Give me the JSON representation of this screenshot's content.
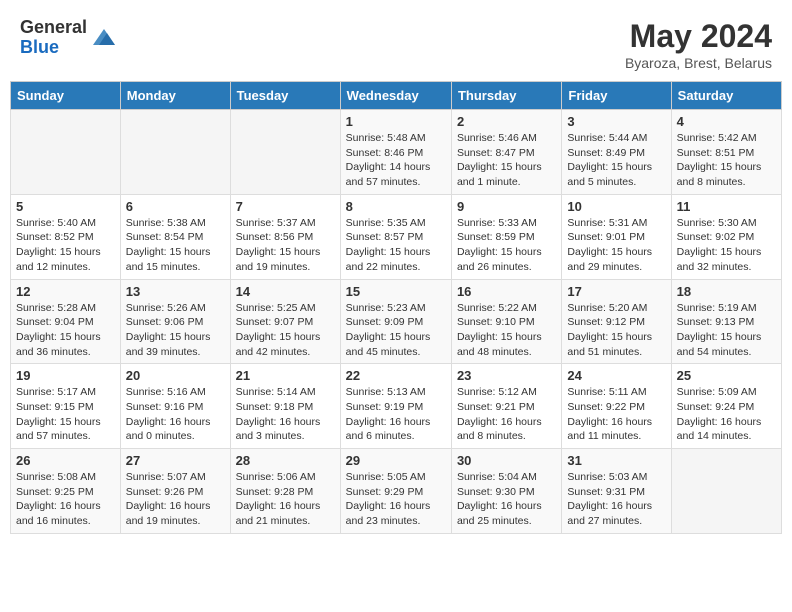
{
  "header": {
    "logo_line1": "General",
    "logo_line2": "Blue",
    "month": "May 2024",
    "location": "Byaroza, Brest, Belarus"
  },
  "weekdays": [
    "Sunday",
    "Monday",
    "Tuesday",
    "Wednesday",
    "Thursday",
    "Friday",
    "Saturday"
  ],
  "weeks": [
    [
      {
        "day": "",
        "info": ""
      },
      {
        "day": "",
        "info": ""
      },
      {
        "day": "",
        "info": ""
      },
      {
        "day": "1",
        "info": "Sunrise: 5:48 AM\nSunset: 8:46 PM\nDaylight: 14 hours\nand 57 minutes."
      },
      {
        "day": "2",
        "info": "Sunrise: 5:46 AM\nSunset: 8:47 PM\nDaylight: 15 hours\nand 1 minute."
      },
      {
        "day": "3",
        "info": "Sunrise: 5:44 AM\nSunset: 8:49 PM\nDaylight: 15 hours\nand 5 minutes."
      },
      {
        "day": "4",
        "info": "Sunrise: 5:42 AM\nSunset: 8:51 PM\nDaylight: 15 hours\nand 8 minutes."
      }
    ],
    [
      {
        "day": "5",
        "info": "Sunrise: 5:40 AM\nSunset: 8:52 PM\nDaylight: 15 hours\nand 12 minutes."
      },
      {
        "day": "6",
        "info": "Sunrise: 5:38 AM\nSunset: 8:54 PM\nDaylight: 15 hours\nand 15 minutes."
      },
      {
        "day": "7",
        "info": "Sunrise: 5:37 AM\nSunset: 8:56 PM\nDaylight: 15 hours\nand 19 minutes."
      },
      {
        "day": "8",
        "info": "Sunrise: 5:35 AM\nSunset: 8:57 PM\nDaylight: 15 hours\nand 22 minutes."
      },
      {
        "day": "9",
        "info": "Sunrise: 5:33 AM\nSunset: 8:59 PM\nDaylight: 15 hours\nand 26 minutes."
      },
      {
        "day": "10",
        "info": "Sunrise: 5:31 AM\nSunset: 9:01 PM\nDaylight: 15 hours\nand 29 minutes."
      },
      {
        "day": "11",
        "info": "Sunrise: 5:30 AM\nSunset: 9:02 PM\nDaylight: 15 hours\nand 32 minutes."
      }
    ],
    [
      {
        "day": "12",
        "info": "Sunrise: 5:28 AM\nSunset: 9:04 PM\nDaylight: 15 hours\nand 36 minutes."
      },
      {
        "day": "13",
        "info": "Sunrise: 5:26 AM\nSunset: 9:06 PM\nDaylight: 15 hours\nand 39 minutes."
      },
      {
        "day": "14",
        "info": "Sunrise: 5:25 AM\nSunset: 9:07 PM\nDaylight: 15 hours\nand 42 minutes."
      },
      {
        "day": "15",
        "info": "Sunrise: 5:23 AM\nSunset: 9:09 PM\nDaylight: 15 hours\nand 45 minutes."
      },
      {
        "day": "16",
        "info": "Sunrise: 5:22 AM\nSunset: 9:10 PM\nDaylight: 15 hours\nand 48 minutes."
      },
      {
        "day": "17",
        "info": "Sunrise: 5:20 AM\nSunset: 9:12 PM\nDaylight: 15 hours\nand 51 minutes."
      },
      {
        "day": "18",
        "info": "Sunrise: 5:19 AM\nSunset: 9:13 PM\nDaylight: 15 hours\nand 54 minutes."
      }
    ],
    [
      {
        "day": "19",
        "info": "Sunrise: 5:17 AM\nSunset: 9:15 PM\nDaylight: 15 hours\nand 57 minutes."
      },
      {
        "day": "20",
        "info": "Sunrise: 5:16 AM\nSunset: 9:16 PM\nDaylight: 16 hours\nand 0 minutes."
      },
      {
        "day": "21",
        "info": "Sunrise: 5:14 AM\nSunset: 9:18 PM\nDaylight: 16 hours\nand 3 minutes."
      },
      {
        "day": "22",
        "info": "Sunrise: 5:13 AM\nSunset: 9:19 PM\nDaylight: 16 hours\nand 6 minutes."
      },
      {
        "day": "23",
        "info": "Sunrise: 5:12 AM\nSunset: 9:21 PM\nDaylight: 16 hours\nand 8 minutes."
      },
      {
        "day": "24",
        "info": "Sunrise: 5:11 AM\nSunset: 9:22 PM\nDaylight: 16 hours\nand 11 minutes."
      },
      {
        "day": "25",
        "info": "Sunrise: 5:09 AM\nSunset: 9:24 PM\nDaylight: 16 hours\nand 14 minutes."
      }
    ],
    [
      {
        "day": "26",
        "info": "Sunrise: 5:08 AM\nSunset: 9:25 PM\nDaylight: 16 hours\nand 16 minutes."
      },
      {
        "day": "27",
        "info": "Sunrise: 5:07 AM\nSunset: 9:26 PM\nDaylight: 16 hours\nand 19 minutes."
      },
      {
        "day": "28",
        "info": "Sunrise: 5:06 AM\nSunset: 9:28 PM\nDaylight: 16 hours\nand 21 minutes."
      },
      {
        "day": "29",
        "info": "Sunrise: 5:05 AM\nSunset: 9:29 PM\nDaylight: 16 hours\nand 23 minutes."
      },
      {
        "day": "30",
        "info": "Sunrise: 5:04 AM\nSunset: 9:30 PM\nDaylight: 16 hours\nand 25 minutes."
      },
      {
        "day": "31",
        "info": "Sunrise: 5:03 AM\nSunset: 9:31 PM\nDaylight: 16 hours\nand 27 minutes."
      },
      {
        "day": "",
        "info": ""
      }
    ]
  ]
}
